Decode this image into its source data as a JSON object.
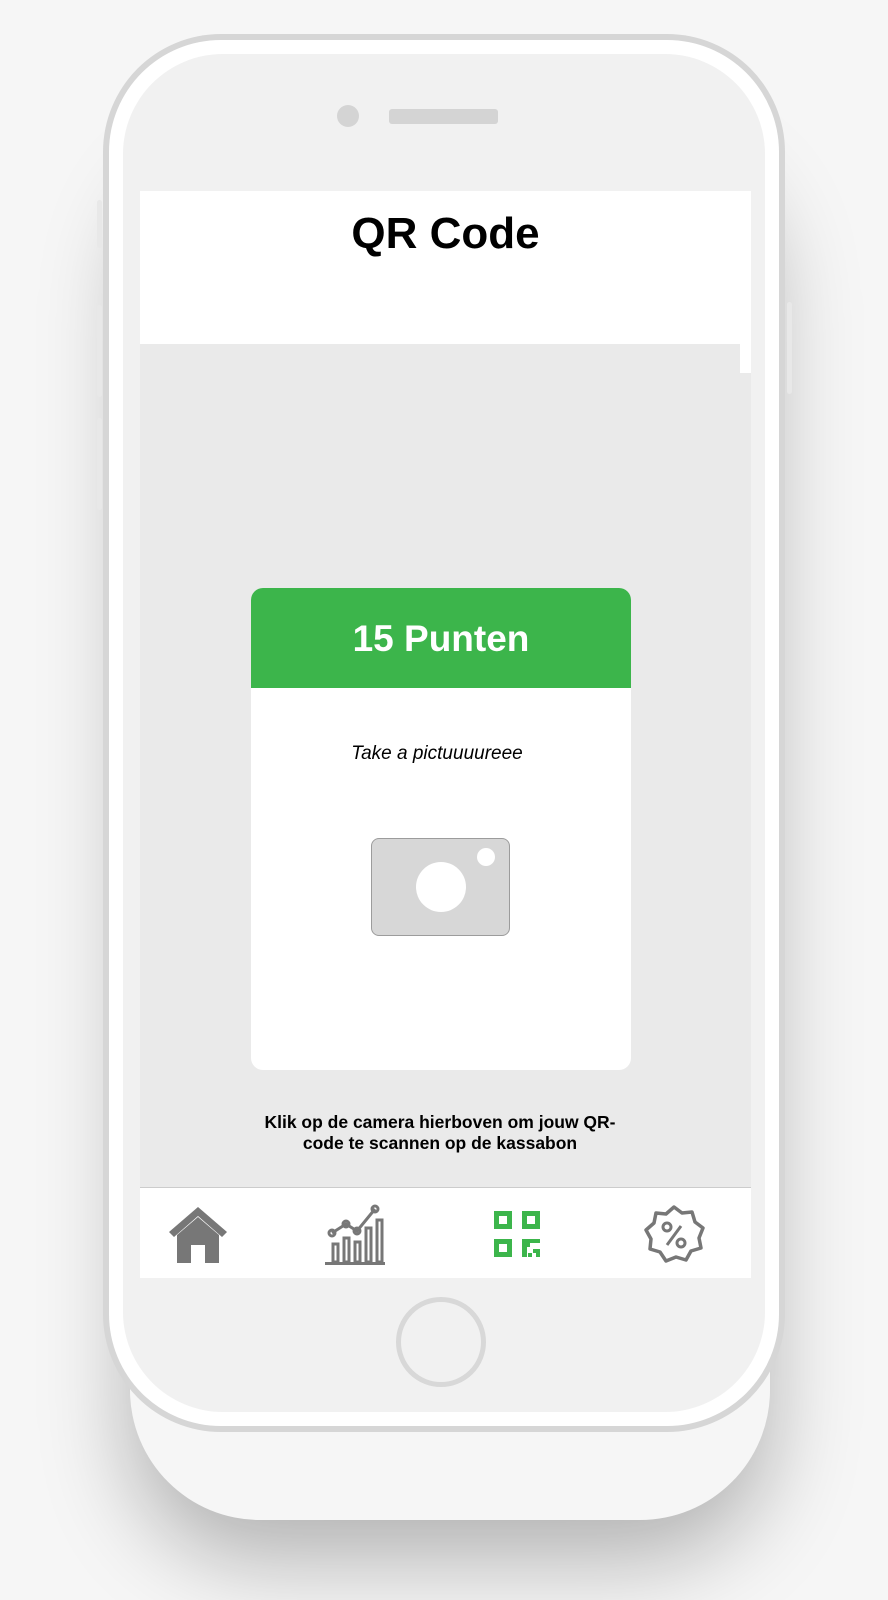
{
  "header": {
    "title": "QR Code"
  },
  "card": {
    "points_label": "15 Punten",
    "caption": "Take a pictuuuureee",
    "camera_icon": "camera-icon"
  },
  "instructions": "Klik op de camera hierboven om jouw QR-code te scannen op de kassabon",
  "tabbar": {
    "items": [
      {
        "icon": "home-icon",
        "active": false
      },
      {
        "icon": "chart-icon",
        "active": false
      },
      {
        "icon": "qr-code-icon",
        "active": true
      },
      {
        "icon": "discount-badge-icon",
        "active": false
      }
    ]
  },
  "colors": {
    "accent_green": "#3cb54b",
    "icon_gray": "#777777",
    "content_background": "#eaeaea"
  }
}
